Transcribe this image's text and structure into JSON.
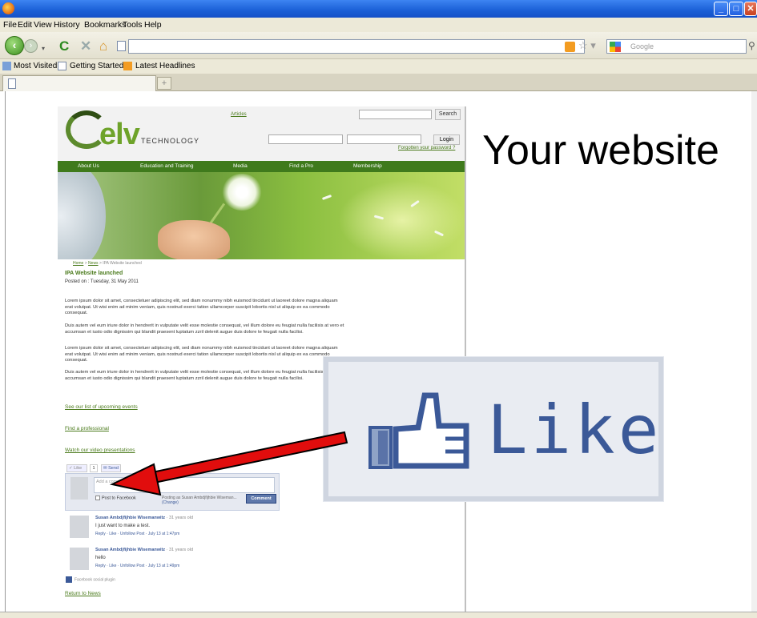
{
  "browser": {
    "menu": [
      "File",
      "Edit",
      "View",
      "History",
      "Bookmarks",
      "Tools",
      "Help"
    ],
    "search_placeholder": "Google",
    "bookmarks": [
      "Most Visited",
      "Getting Started",
      "Latest Headlines"
    ],
    "new_tab_symbol": "+"
  },
  "site": {
    "logo_main": "elv",
    "logo_sub": "TECHNOLOGY",
    "articles_link": "Articles",
    "search_button": "Search",
    "login_button": "Login",
    "forgot_password": "Forgotten your password ?",
    "nav": [
      "About Us",
      "Education and Training",
      "Media",
      "Find a Pro",
      "Membership"
    ],
    "breadcrumb": {
      "home": "Home",
      "sep": ">",
      "news": "News",
      "current": "IPA Website launched"
    },
    "article_title": "IPA Website launched",
    "posted_on": "Posted on : Tuesday, 31 May 2011",
    "paragraphs": [
      "Lorem ipsum dolor sit amet, consectetuer adipiscing elit, sed diam nonummy nibh euismod tincidunt ut laoreet dolore magna aliquam erat volutpat. Ut wisi enim ad minim veniam, quis nostrud exerci tation ullamcorper suscipit lobortis nisl ut aliquip ex ea commodo consequat.",
      "Duis autem vel eum iriure dolor in hendrerit in vulputate velit esse molestie consequat, vel illum dolore eu feugiat nulla facilisis at vero et accumsan et iusto odio dignissim qui blandit praesent luptatum zzril delenit augue duis dolore te feugait nulla facilisi.",
      "Lorem ipsum dolor sit amet, consectetuer adipiscing elit, sed diam nonummy nibh euismod tincidunt ut laoreet dolore magna aliquam erat volutpat. Ut wisi enim ad minim veniam, quis nostrud exerci tation ullamcorper suscipit lobortis nisl ut aliquip ex ea commodo consequat.",
      "Duis autem vel eum iriure dolor in hendrerit in vulputate velit esse molestie consequat, vel illum dolore eu feugiat nulla facilisis at vero et accumsan et iusto odio dignissim qui blandit praesent luptatum zzril delenit augue duis dolore te feugait nulla facilisi."
    ],
    "links": [
      "See our list of upcoming events",
      "Find a professional",
      "Watch our video presentations"
    ],
    "return_link": "Return to News"
  },
  "facebook": {
    "like_label": "Like",
    "like_count": "1",
    "send_label": "Send",
    "comment_placeholder": "Add a comment...",
    "post_to_facebook": "Post to Facebook",
    "posting_as": "Posting as Susan Ambdjfijhbie Wiseman...",
    "change": "(Change)",
    "comment_button": "Comment",
    "comments": [
      {
        "name": "Susan Ambdjfijhbie Wisemanwitz",
        "age": " · 31 years old",
        "text": "I just want to make a test.",
        "actions": "Reply · Like · Unfollow Post · July 13 at 1:47pm"
      },
      {
        "name": "Susan Ambdjfijhbie Wisemanwitz",
        "age": " · 31 years old",
        "text": "hello",
        "actions": "Reply · Like · Unfollow Post · July 13 at 1:49pm"
      }
    ],
    "social_plugin": "Facebook social plugin"
  },
  "overlay": {
    "your_website": "Your website",
    "big_like": "Like"
  },
  "colors": {
    "brand_green": "#4a7a1b",
    "nav_green": "#3f7a1c",
    "facebook_blue": "#3b5998",
    "arrow_red": "#e10d0d"
  }
}
